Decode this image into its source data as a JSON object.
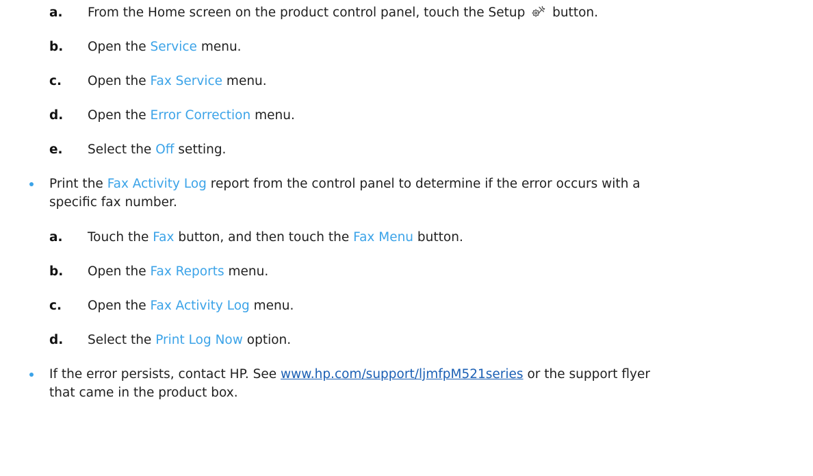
{
  "steps_a": [
    {
      "marker": "a.",
      "parts": [
        "From the Home screen on the product control panel, touch the Setup",
        "button."
      ]
    },
    {
      "marker": "b.",
      "pre": "Open the",
      "ui": "Service",
      "post": "menu."
    },
    {
      "marker": "c.",
      "pre": "Open the",
      "ui": "Fax Service",
      "post": "menu."
    },
    {
      "marker": "d.",
      "pre": "Open the",
      "ui": "Error Correction",
      "post": "menu."
    },
    {
      "marker": "e.",
      "pre": "Select the",
      "ui": "Off",
      "post": "setting."
    }
  ],
  "bullet_log": {
    "line1_pre": "Print the",
    "line1_ui": "Fax Activity Log",
    "line1_post": "report from the control panel to determine if the error occurs with a",
    "line2": "specific fax number."
  },
  "steps_b": [
    {
      "marker": "a.",
      "pre": "Touch the",
      "ui1": "Fax",
      "mid": "button, and then touch the",
      "ui2": "Fax Menu",
      "post": "button."
    },
    {
      "marker": "b.",
      "pre": "Open the",
      "ui": "Fax Reports",
      "post": "menu."
    },
    {
      "marker": "c.",
      "pre": "Open the",
      "ui": "Fax Activity Log",
      "post": "menu."
    },
    {
      "marker": "d.",
      "pre": "Select the",
      "ui": "Print Log Now",
      "post": "option."
    }
  ],
  "bullet_contact": {
    "line1_pre": "If the error persists, contact HP. See",
    "link": "www.hp.com/support/ljmfpM521series",
    "line1_post": "or the support flyer",
    "line2": "that came in the product box."
  },
  "icons": {
    "setup": "setup-wrench-gear-icon"
  },
  "colors": {
    "ui_text": "#3ba3e8",
    "link": "#1a5fb4",
    "body_text": "#1f1f1f"
  }
}
